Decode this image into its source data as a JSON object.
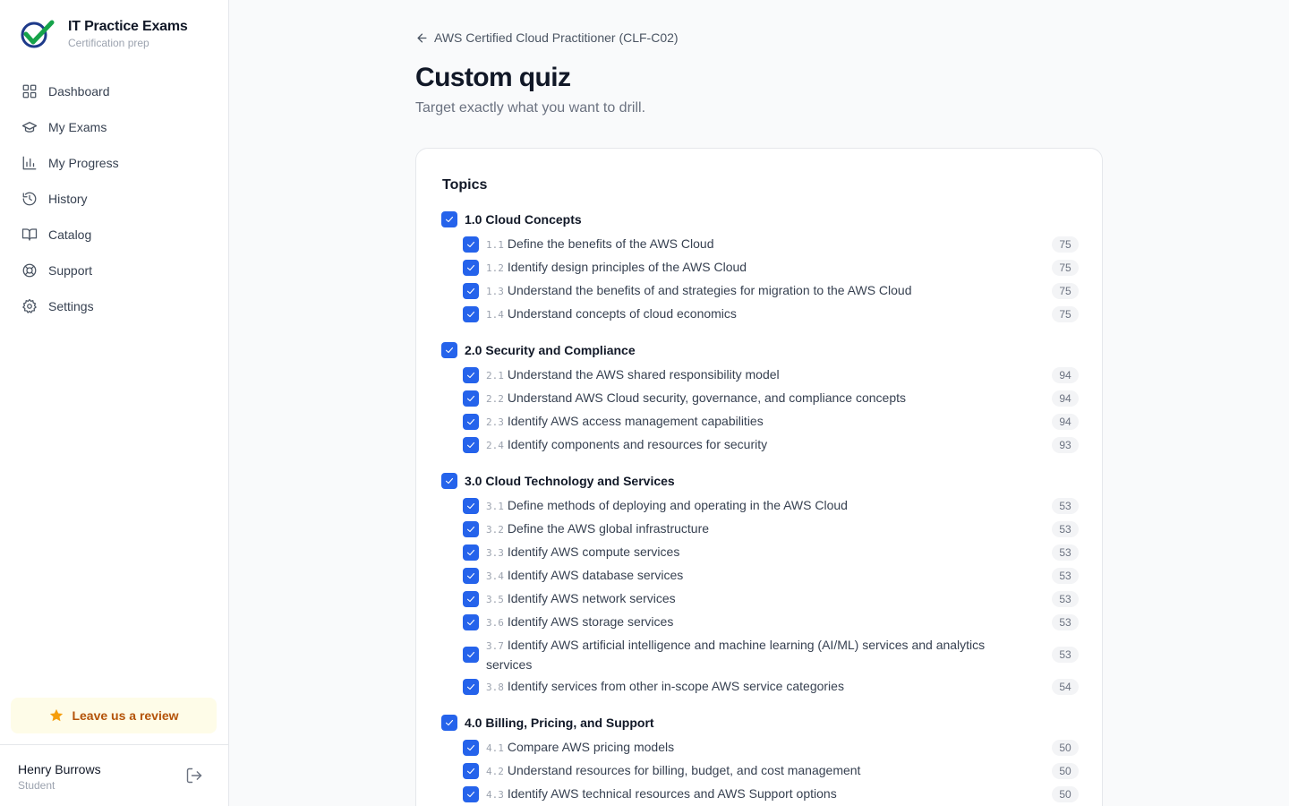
{
  "brand": {
    "title": "IT Practice Exams",
    "subtitle": "Certification prep",
    "logo_icon": "check-badge-logo",
    "accent": "#16a34a",
    "accent2": "#1e3a8a"
  },
  "sidebar": {
    "items": [
      {
        "label": "Dashboard",
        "icon": "grid-icon"
      },
      {
        "label": "My Exams",
        "icon": "graduation-cap-icon"
      },
      {
        "label": "My Progress",
        "icon": "bar-chart-icon"
      },
      {
        "label": "History",
        "icon": "history-icon"
      },
      {
        "label": "Catalog",
        "icon": "book-open-icon"
      },
      {
        "label": "Support",
        "icon": "lifebuoy-icon"
      },
      {
        "label": "Settings",
        "icon": "gear-icon"
      }
    ],
    "review_label": "Leave us a review",
    "user": {
      "name": "Henry Burrows",
      "role": "Student"
    }
  },
  "main": {
    "back_label": "AWS Certified Cloud Practitioner (CLF-C02)",
    "title": "Custom quiz",
    "subtitle": "Target exactly what you want to drill.",
    "topics_heading": "Topics",
    "domains": [
      {
        "label": "1.0 Cloud Concepts",
        "checked": true,
        "subs": [
          {
            "code": "1.1",
            "label": "Define the benefits of the AWS Cloud",
            "count": "75",
            "checked": true
          },
          {
            "code": "1.2",
            "label": "Identify design principles of the AWS Cloud",
            "count": "75",
            "checked": true
          },
          {
            "code": "1.3",
            "label": "Understand the benefits of and strategies for migration to the AWS Cloud",
            "count": "75",
            "checked": true
          },
          {
            "code": "1.4",
            "label": "Understand concepts of cloud economics",
            "count": "75",
            "checked": true
          }
        ]
      },
      {
        "label": "2.0 Security and Compliance",
        "checked": true,
        "subs": [
          {
            "code": "2.1",
            "label": "Understand the AWS shared responsibility model",
            "count": "94",
            "checked": true
          },
          {
            "code": "2.2",
            "label": "Understand AWS Cloud security, governance, and compliance concepts",
            "count": "94",
            "checked": true
          },
          {
            "code": "2.3",
            "label": "Identify AWS access management capabilities",
            "count": "94",
            "checked": true
          },
          {
            "code": "2.4",
            "label": "Identify components and resources for security",
            "count": "93",
            "checked": true
          }
        ]
      },
      {
        "label": "3.0 Cloud Technology and Services",
        "checked": true,
        "subs": [
          {
            "code": "3.1",
            "label": "Define methods of deploying and operating in the AWS Cloud",
            "count": "53",
            "checked": true
          },
          {
            "code": "3.2",
            "label": "Define the AWS global infrastructure",
            "count": "53",
            "checked": true
          },
          {
            "code": "3.3",
            "label": "Identify AWS compute services",
            "count": "53",
            "checked": true
          },
          {
            "code": "3.4",
            "label": "Identify AWS database services",
            "count": "53",
            "checked": true
          },
          {
            "code": "3.5",
            "label": "Identify AWS network services",
            "count": "53",
            "checked": true
          },
          {
            "code": "3.6",
            "label": "Identify AWS storage services",
            "count": "53",
            "checked": true
          },
          {
            "code": "3.7",
            "label": "Identify AWS artificial intelligence and machine learning (AI/ML) services and analytics services",
            "count": "53",
            "checked": true
          },
          {
            "code": "3.8",
            "label": "Identify services from other in-scope AWS service categories",
            "count": "54",
            "checked": true
          }
        ]
      },
      {
        "label": "4.0 Billing, Pricing, and Support",
        "checked": true,
        "subs": [
          {
            "code": "4.1",
            "label": "Compare AWS pricing models",
            "count": "50",
            "checked": true
          },
          {
            "code": "4.2",
            "label": "Understand resources for billing, budget, and cost management",
            "count": "50",
            "checked": true
          },
          {
            "code": "4.3",
            "label": "Identify AWS technical resources and AWS Support options",
            "count": "50",
            "checked": true
          }
        ]
      }
    ]
  },
  "colors": {
    "checkbox": "#2563eb",
    "review_bg": "#fefce8",
    "review_text": "#b45309",
    "star": "#f59e0b"
  }
}
